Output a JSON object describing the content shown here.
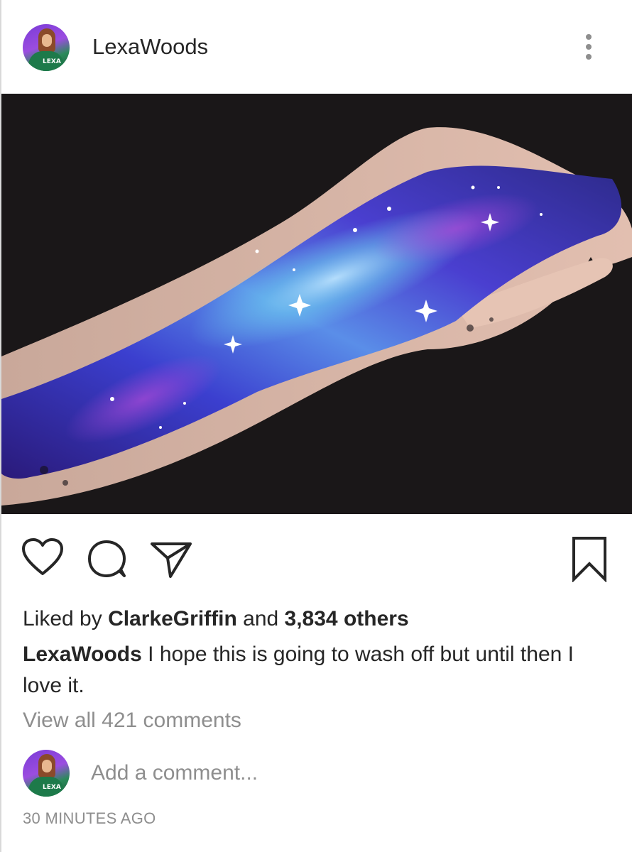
{
  "post": {
    "username": "LexaWoods",
    "avatar_jersey_text": "LEXA",
    "photo_alt": "Galaxy body paint on arm"
  },
  "actions": {
    "like_icon": "heart-outline-icon",
    "comment_icon": "speech-bubble-icon",
    "share_icon": "paper-plane-icon",
    "save_icon": "bookmark-icon"
  },
  "likes": {
    "prefix": "Liked by ",
    "liked_by_user": "ClarkeGriffin",
    "connector": " and ",
    "others": "3,834 others"
  },
  "caption": {
    "username": "LexaWoods",
    "text": " I hope this is going to wash off but until then I love it."
  },
  "comments": {
    "view_all": "View all 421 comments",
    "placeholder": "Add a comment..."
  },
  "timestamp": "30 MINUTES AGO",
  "colors": {
    "text": "#262626",
    "secondary": "#8e8e8e",
    "photo_bg": "#1a1718",
    "galaxy_blue": "#3b3fcf",
    "galaxy_purple": "#6a2bb8",
    "galaxy_cyan": "#6fd3f0"
  }
}
